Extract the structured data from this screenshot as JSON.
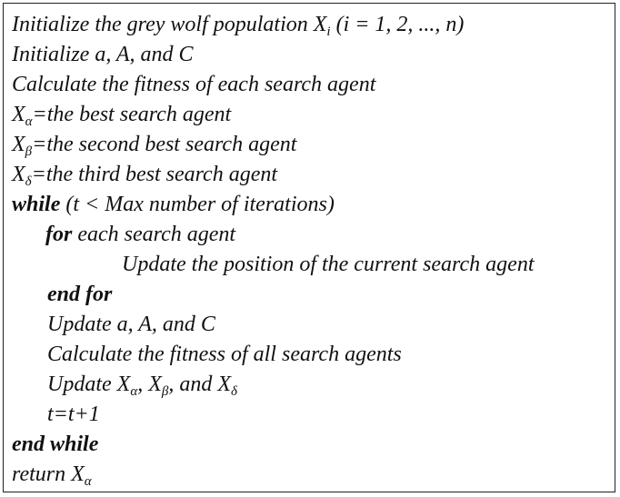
{
  "algorithm": {
    "lines": [
      {
        "parts": [
          "Initialize the grey wolf population X",
          "i",
          " (i = 1, 2, ..., n)"
        ]
      },
      {
        "parts": [
          "Initialize a, A, and C"
        ]
      },
      {
        "parts": [
          "Calculate the fitness of each search agent"
        ]
      },
      {
        "parts": [
          "X",
          "α",
          "=the best search agent"
        ]
      },
      {
        "parts": [
          "X",
          "β",
          "=the second best search agent"
        ]
      },
      {
        "parts": [
          "X",
          "δ",
          "=the third best search agent"
        ]
      },
      {
        "keyword": "while",
        "parts": [
          " (t < Max number of iterations)"
        ]
      },
      {
        "keyword": "for",
        "parts": [
          " each search agent"
        ]
      },
      {
        "parts": [
          "Update the position of the current search agent"
        ]
      },
      {
        "keyword": "end for"
      },
      {
        "parts": [
          "Update a, A, and C"
        ]
      },
      {
        "parts": [
          "Calculate the fitness of all search agents"
        ]
      },
      {
        "parts": [
          "Update X",
          "α",
          ", X",
          "β",
          ", and X",
          "δ"
        ]
      },
      {
        "parts": [
          "t=t+1"
        ]
      },
      {
        "keyword": "end while"
      },
      {
        "parts": [
          "return X",
          "α"
        ]
      }
    ]
  }
}
